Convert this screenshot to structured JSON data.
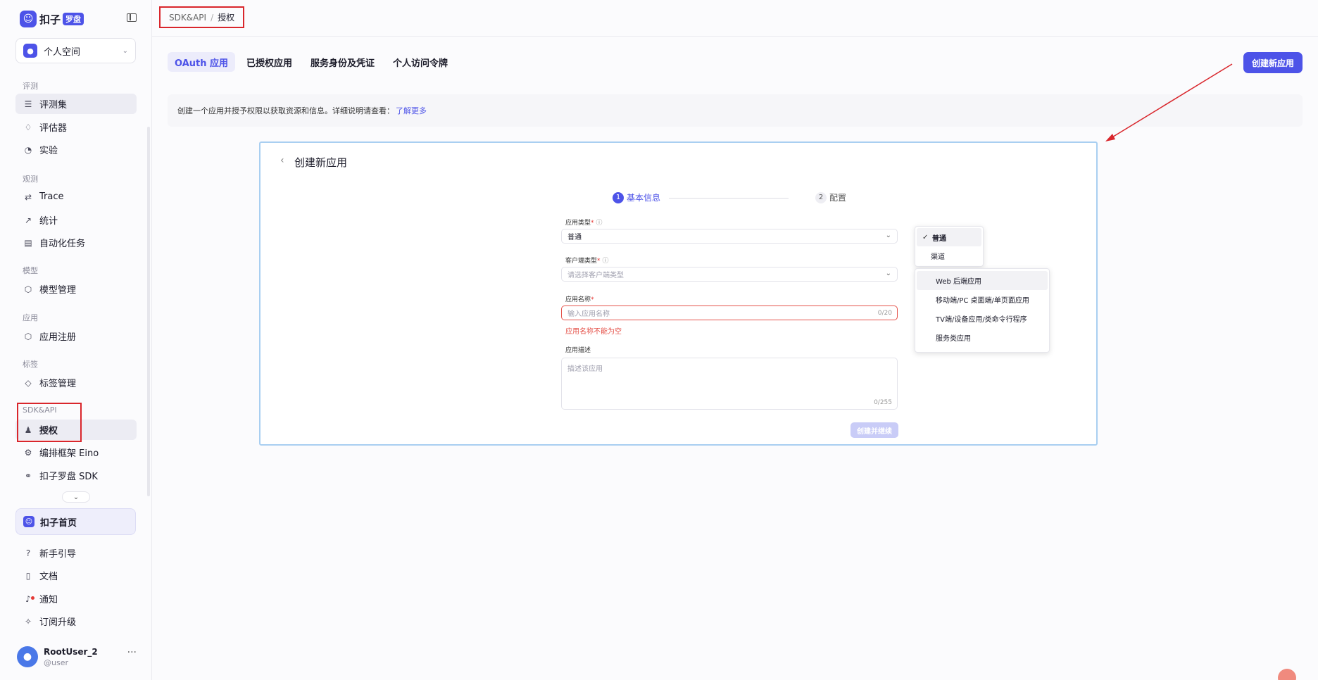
{
  "brand": {
    "name": "扣子",
    "badge": "罗盘"
  },
  "space": {
    "label": "个人空间"
  },
  "sidebar": {
    "sections": {
      "eval": "评测",
      "observe": "观测",
      "model": "模型",
      "app": "应用",
      "tag": "标签",
      "sdk": "SDK&API"
    },
    "items": {
      "eval_set": "评测集",
      "evaluator": "评估器",
      "experiment": "实验",
      "trace": "Trace",
      "stats": "统计",
      "automation": "自动化任务",
      "model_mgmt": "模型管理",
      "app_register": "应用注册",
      "tag_mgmt": "标签管理",
      "auth": "授权",
      "eino": "编排框架 Eino",
      "sdk": "扣子罗盘 SDK"
    },
    "home": "扣子首页",
    "bottom": {
      "guide": "新手引导",
      "docs": "文档",
      "notify": "通知",
      "upgrade": "订阅升级"
    }
  },
  "user": {
    "name": "RootUser_2",
    "handle": "@user"
  },
  "breadcrumb": {
    "parent": "SDK&API",
    "sep": "/",
    "current": "授权"
  },
  "tabs": [
    "OAuth 应用",
    "已授权应用",
    "服务身份及凭证",
    "个人访问令牌"
  ],
  "create_button": "创建新应用",
  "info": {
    "text": "创建一个应用并授予权限以获取资源和信息。详细说明请查看：",
    "link": "了解更多"
  },
  "dialog": {
    "title": "创建新应用",
    "steps": [
      {
        "num": "1",
        "label": "基本信息"
      },
      {
        "num": "2",
        "label": "配置"
      }
    ],
    "fields": {
      "app_type": {
        "label": "应用类型",
        "value": "普通"
      },
      "client_type": {
        "label": "客户端类型",
        "placeholder": "请选择客户端类型"
      },
      "app_name": {
        "label": "应用名称",
        "placeholder": "输入应用名称",
        "count": "0/20",
        "error": "应用名称不能为空"
      },
      "app_desc": {
        "label": "应用描述",
        "placeholder": "描述该应用",
        "count": "0/255"
      }
    },
    "submit": "创建并继续"
  },
  "dropdown_app_type": [
    "普通",
    "渠道"
  ],
  "dropdown_client_type": [
    "Web 后端应用",
    "移动端/PC 桌面端/单页面应用",
    "TV端/设备应用/类命令行程序",
    "服务类应用"
  ],
  "colors": {
    "accent": "#4d53e8",
    "error": "#e5534b",
    "annotation": "#d9262c"
  }
}
